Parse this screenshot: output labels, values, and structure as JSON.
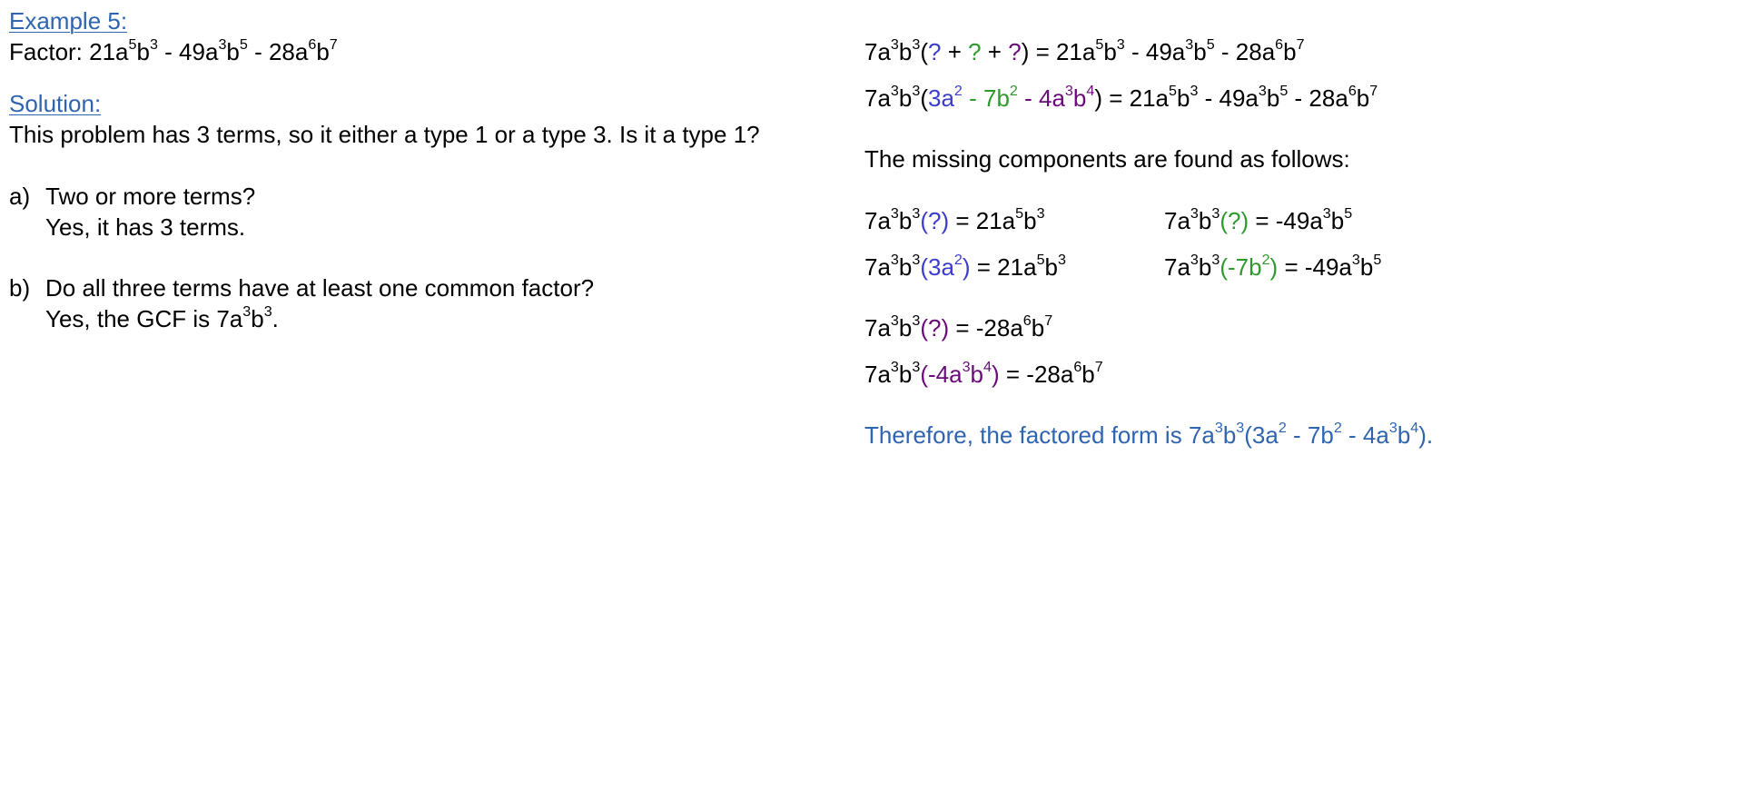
{
  "colors": {
    "text": "#000000",
    "heading": "#2f64b0",
    "blue": "#3c3ccc",
    "green": "#2e9a2e",
    "purple": "#6a0a7a",
    "conclusion": "#2f64b0"
  },
  "left": {
    "heading": "Example 5:",
    "factor_label": "Factor:  ",
    "solution_heading": "Solution:",
    "intro": "This problem has 3 terms, so it either a type 1 or a type 3.  Is it a type 1?",
    "q_a_letter": "a)",
    "q_a": "Two or more terms?",
    "q_a_answer": "Yes, it has 3 terms.",
    "q_b_letter": "b)",
    "q_b": "Do all three terms have at least one common factor?",
    "q_b_answer_prefix": "Yes, the GCF is "
  },
  "right": {
    "missing_intro": "The missing components are found as follows:",
    "conclusion_prefix": "Therefore, the factored form is "
  },
  "math": {
    "polynomial": [
      [
        "21a",
        "5"
      ],
      [
        "b",
        "3"
      ],
      [
        " - 49a",
        "3"
      ],
      [
        "b",
        "5"
      ],
      [
        " - 28a",
        "6"
      ],
      [
        "b",
        "7"
      ]
    ],
    "gcf": [
      [
        "7a",
        "3"
      ],
      [
        "b",
        "3"
      ]
    ],
    "gcf_period": [
      [
        "7a",
        "3"
      ],
      [
        "b",
        "3"
      ],
      [
        ".",
        ""
      ]
    ],
    "eq1": [
      {
        "c": "text",
        "s": [
          [
            "7a",
            "3"
          ],
          [
            "b",
            "3"
          ],
          [
            "(",
            ""
          ]
        ]
      },
      {
        "c": "blue",
        "s": [
          [
            "?",
            ""
          ]
        ]
      },
      {
        "c": "text",
        "s": [
          [
            " + ",
            ""
          ]
        ]
      },
      {
        "c": "green",
        "s": [
          [
            "?",
            ""
          ]
        ]
      },
      {
        "c": "text",
        "s": [
          [
            " + ",
            ""
          ]
        ]
      },
      {
        "c": "purple",
        "s": [
          [
            "?",
            ""
          ]
        ]
      },
      {
        "c": "text",
        "s": [
          [
            ") = 21a",
            "5"
          ],
          [
            "b",
            "3"
          ],
          [
            " - 49a",
            "3"
          ],
          [
            "b",
            "5"
          ],
          [
            " - 28a",
            "6"
          ],
          [
            "b",
            "7"
          ]
        ]
      }
    ],
    "eq2": [
      {
        "c": "text",
        "s": [
          [
            "7a",
            "3"
          ],
          [
            "b",
            "3"
          ],
          [
            "(",
            ""
          ]
        ]
      },
      {
        "c": "blue",
        "s": [
          [
            "3a",
            "2"
          ]
        ]
      },
      {
        "c": "green",
        "s": [
          [
            " - 7b",
            "2"
          ]
        ]
      },
      {
        "c": "purple",
        "s": [
          [
            " - 4a",
            "3"
          ],
          [
            "b",
            "4"
          ]
        ]
      },
      {
        "c": "text",
        "s": [
          [
            ") = 21a",
            "5"
          ],
          [
            "b",
            "3"
          ],
          [
            " - 49a",
            "3"
          ],
          [
            "b",
            "5"
          ],
          [
            " - 28a",
            "6"
          ],
          [
            "b",
            "7"
          ]
        ]
      }
    ],
    "m1": [
      {
        "c": "text",
        "s": [
          [
            "7a",
            "3"
          ],
          [
            "b",
            "3"
          ]
        ]
      },
      {
        "c": "blue",
        "s": [
          [
            "(?)",
            ""
          ]
        ]
      },
      {
        "c": "text",
        "s": [
          [
            " = 21a",
            "5"
          ],
          [
            "b",
            "3"
          ]
        ]
      }
    ],
    "m1_ans": [
      {
        "c": "text",
        "s": [
          [
            "7a",
            "3"
          ],
          [
            "b",
            "3"
          ]
        ]
      },
      {
        "c": "blue",
        "s": [
          [
            "(3a",
            "2"
          ],
          [
            ")",
            ""
          ]
        ]
      },
      {
        "c": "text",
        "s": [
          [
            " = 21a",
            "5"
          ],
          [
            "b",
            "3"
          ]
        ]
      }
    ],
    "m2": [
      {
        "c": "text",
        "s": [
          [
            "7a",
            "3"
          ],
          [
            "b",
            "3"
          ]
        ]
      },
      {
        "c": "green",
        "s": [
          [
            "(?)",
            ""
          ]
        ]
      },
      {
        "c": "text",
        "s": [
          [
            " = -49a",
            "3"
          ],
          [
            "b",
            "5"
          ]
        ]
      }
    ],
    "m2_ans": [
      {
        "c": "text",
        "s": [
          [
            "7a",
            "3"
          ],
          [
            "b",
            "3"
          ]
        ]
      },
      {
        "c": "green",
        "s": [
          [
            "(-7b",
            "2"
          ],
          [
            ")",
            ""
          ]
        ]
      },
      {
        "c": "text",
        "s": [
          [
            " = -49a",
            "3"
          ],
          [
            "b",
            "5"
          ]
        ]
      }
    ],
    "m3": [
      {
        "c": "text",
        "s": [
          [
            "7a",
            "3"
          ],
          [
            "b",
            "3"
          ]
        ]
      },
      {
        "c": "purple",
        "s": [
          [
            "(?)",
            ""
          ]
        ]
      },
      {
        "c": "text",
        "s": [
          [
            " = -28a",
            "6"
          ],
          [
            "b",
            "7"
          ]
        ]
      }
    ],
    "m3_ans": [
      {
        "c": "text",
        "s": [
          [
            "7a",
            "3"
          ],
          [
            "b",
            "3"
          ]
        ]
      },
      {
        "c": "purple",
        "s": [
          [
            "(-4a",
            "3"
          ],
          [
            "b",
            "4"
          ],
          [
            ")",
            ""
          ]
        ]
      },
      {
        "c": "text",
        "s": [
          [
            " = -28a",
            "6"
          ],
          [
            "b",
            "7"
          ]
        ]
      }
    ],
    "conclusion_expr": [
      [
        "7a",
        "3"
      ],
      [
        "b",
        "3"
      ],
      [
        "(3a",
        "2"
      ],
      [
        " - 7b",
        "2"
      ],
      [
        " - 4a",
        "3"
      ],
      [
        "b",
        "4"
      ],
      [
        ").",
        ""
      ]
    ]
  }
}
